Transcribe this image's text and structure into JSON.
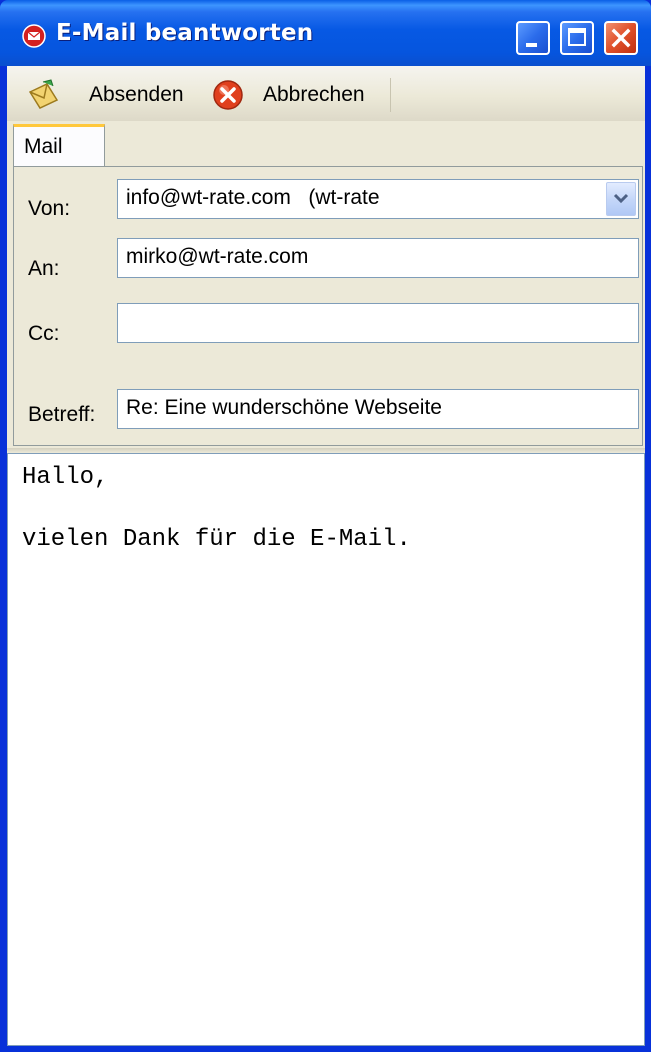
{
  "window": {
    "title": "E-Mail beantworten"
  },
  "toolbar": {
    "send_label": "Absenden",
    "cancel_label": "Abbrechen"
  },
  "tabs": [
    {
      "label": "Mail"
    }
  ],
  "form": {
    "from_label": "Von:",
    "from_value": "info@wt-rate.com   (wt-rate",
    "to_label": "An:",
    "to_value": "mirko@wt-rate.com",
    "cc_label": "Cc:",
    "cc_value": "",
    "subject_label": "Betreff:",
    "subject_value": "Re: Eine wunderschöne Webseite"
  },
  "body": {
    "lines": [
      "Hallo,",
      "",
      "vielen Dank für die E-Mail."
    ]
  },
  "colors": {
    "titlebar": "#0A5FE6",
    "frame": "#0831D9",
    "face": "#ECE9D8",
    "tab_accent": "#FFC83C",
    "close_button": "#E0502A",
    "field_border": "#7F9DB9"
  },
  "icons": {
    "app": "mail-reply-icon",
    "send": "send-envelope-icon",
    "cancel": "cancel-x-icon",
    "minimize": "minimize-icon",
    "maximize": "maximize-icon",
    "close": "close-icon",
    "dropdown": "chevron-down-icon"
  }
}
